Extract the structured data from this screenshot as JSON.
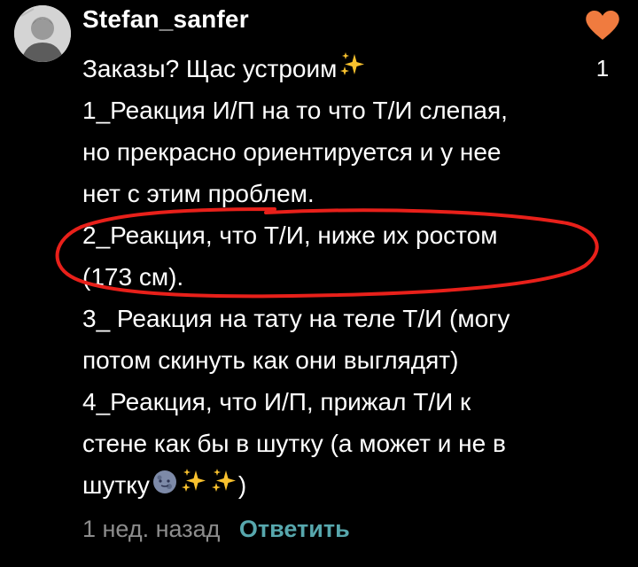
{
  "comment": {
    "username": "Stefan_sanfer",
    "avatar": "avatar-icon",
    "like_icon": "heart-icon",
    "like_count": "1",
    "lines": [
      "Заказы? Щас устроим",
      "1_Реакция И/П на то что Т/И слепая,",
      "но прекрасно ориентируется и у нее",
      "нет с этим проблем.",
      "2_Реакция, что Т/И, ниже их ростом",
      "(173 см).",
      "3_ Реакция на тату на теле Т/И (могу",
      "потом скинуть как они выглядят)",
      "4_Реакция, что И/П, прижал Т/И к",
      "стене как бы в шутку (а может и не в",
      "шутку",
      ")"
    ],
    "emoji": [
      "sparkles-icon",
      "moon-face-icon",
      "sparkles-icon",
      "sparkles-icon"
    ],
    "time": "1 нед. назад",
    "reply_label": "Ответить"
  },
  "colors": {
    "background": "#000000",
    "text": "#ffffff",
    "heart": "#f07b3f",
    "reply": "#57a7ad",
    "time": "#8c8c8c",
    "annotation": "#e8201a"
  }
}
